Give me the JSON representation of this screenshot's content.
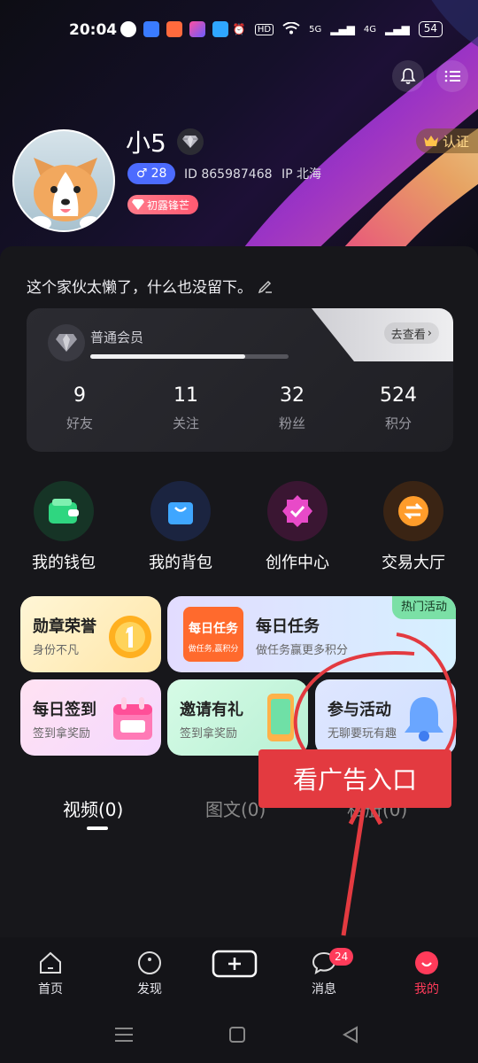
{
  "status": {
    "time": "20:04",
    "hd": "HD",
    "net5g": "5G",
    "net4g": "4G",
    "battery": "54"
  },
  "profile": {
    "nickname": "小5",
    "age": "28",
    "id_text": "ID 865987468",
    "ip_text": "IP 北海",
    "level_badge": "初露锋芒",
    "verify_label": "认证",
    "bio": "这个家伙太懒了，什么也没留下。"
  },
  "member": {
    "label": "普通会员",
    "go_view": "去查看",
    "progress": 0.78,
    "stats": [
      {
        "value": "9",
        "label": "好友"
      },
      {
        "value": "11",
        "label": "关注"
      },
      {
        "value": "32",
        "label": "粉丝"
      },
      {
        "value": "524",
        "label": "积分"
      }
    ]
  },
  "quick_entries": [
    {
      "label": "我的钱包",
      "icon": "wallet-icon"
    },
    {
      "label": "我的背包",
      "icon": "shopping-bag-icon"
    },
    {
      "label": "创作中心",
      "icon": "creation-badge-icon"
    },
    {
      "label": "交易大厅",
      "icon": "exchange-icon"
    }
  ],
  "cards": {
    "medal": {
      "title": "勋章荣誉",
      "subtitle": "身份不凡"
    },
    "daily_task": {
      "title": "每日任务",
      "subtitle": "做任务赢更多积分",
      "tag": "热门活动",
      "logo_main": "每日任务",
      "logo_sub": "做任务,赢积分"
    },
    "sign_in": {
      "title": "每日签到",
      "subtitle": "签到拿奖励"
    },
    "invite": {
      "title": "邀请有礼",
      "subtitle": "签到拿奖励"
    },
    "join": {
      "title": "参与活动",
      "subtitle": "无聊要玩有趣"
    }
  },
  "annotation": {
    "text": "看广告入口"
  },
  "tabs": [
    "视频(0)",
    "图文(0)",
    "相册(0)"
  ],
  "bottom_nav": [
    {
      "label": "首页",
      "icon": "home-icon"
    },
    {
      "label": "发现",
      "icon": "discover-icon"
    },
    {
      "label": "",
      "icon": "add-icon"
    },
    {
      "label": "消息",
      "icon": "message-icon",
      "badge": "24"
    },
    {
      "label": "我的",
      "icon": "profile-icon"
    }
  ],
  "colors": {
    "accent_red": "#ff3b5a",
    "gender_blue": "#4c6bff",
    "annotation_red": "#e33a40"
  }
}
